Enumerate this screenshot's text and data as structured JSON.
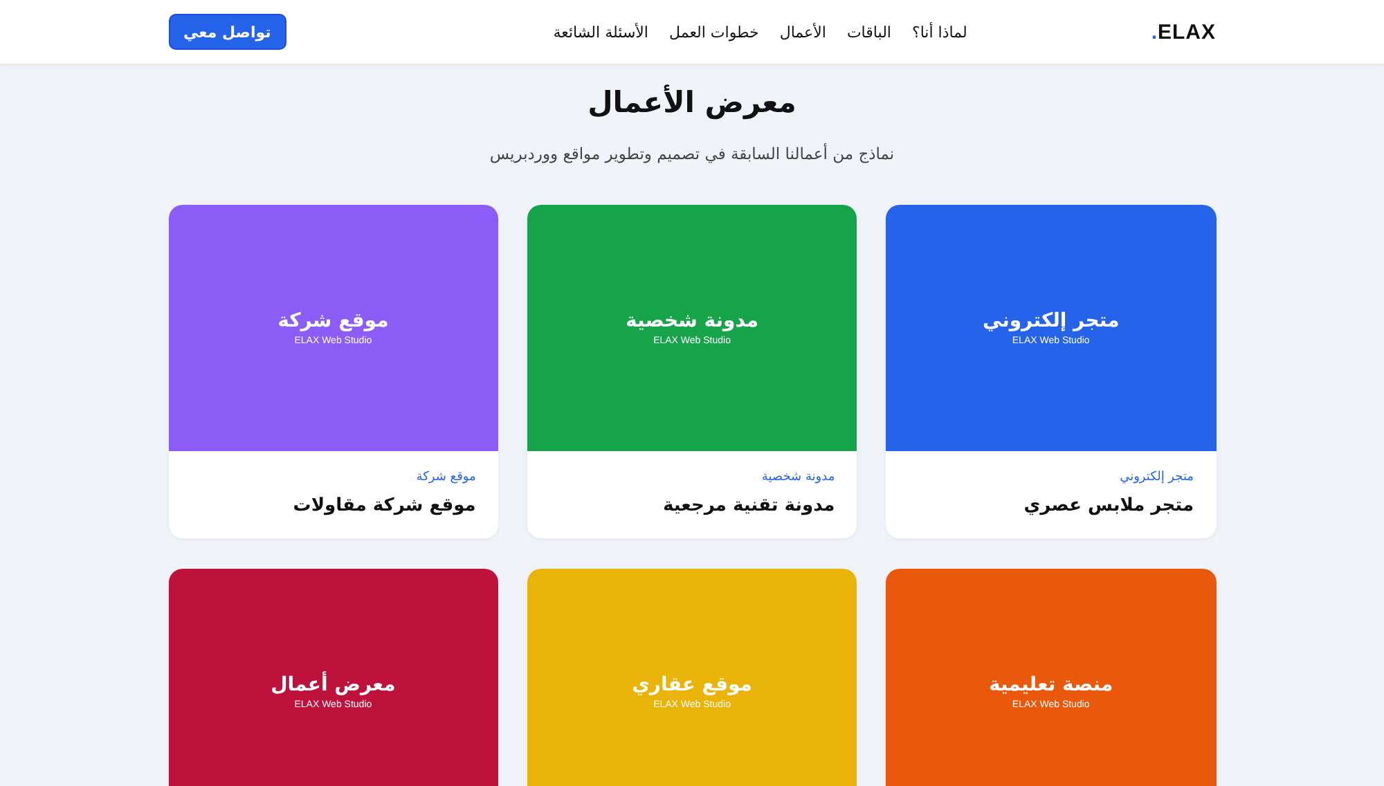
{
  "header": {
    "logo": {
      "text": "ELAX",
      "dot": "."
    },
    "nav": [
      "لماذا أنا؟",
      "الباقات",
      "الأعمال",
      "خطوات العمل",
      "الأسئلة الشائعة"
    ],
    "cta": "تواصل معي"
  },
  "section": {
    "title": "معرض الأعمال",
    "subtitle": "نماذج من أعمالنا السابقة في تصميم وتطوير مواقع ووردبريس"
  },
  "projects": [
    {
      "color": "#2563eb",
      "cover_title": "متجر إلكتروني",
      "cover_subtitle": "ELAX Web Studio",
      "category": "متجر إلكتروني",
      "name": "متجر ملابس عصري"
    },
    {
      "color": "#16a34a",
      "cover_title": "مدونة شخصية",
      "cover_subtitle": "ELAX Web Studio",
      "category": "مدونة شخصية",
      "name": "مدونة تقنية مرجعية"
    },
    {
      "color": "#8b5cf6",
      "cover_title": "موقع شركة",
      "cover_subtitle": "ELAX Web Studio",
      "category": "موقع شركة",
      "name": "موقع شركة مقاولات"
    },
    {
      "color": "#ea580c",
      "cover_title": "منصة تعليمية",
      "cover_subtitle": "ELAX Web Studio"
    },
    {
      "color": "#eab308",
      "cover_title": "موقع عقاري",
      "cover_subtitle": "ELAX Web Studio"
    },
    {
      "color": "#be123c",
      "cover_title": "معرض أعمال",
      "cover_subtitle": "ELAX Web Studio"
    }
  ]
}
